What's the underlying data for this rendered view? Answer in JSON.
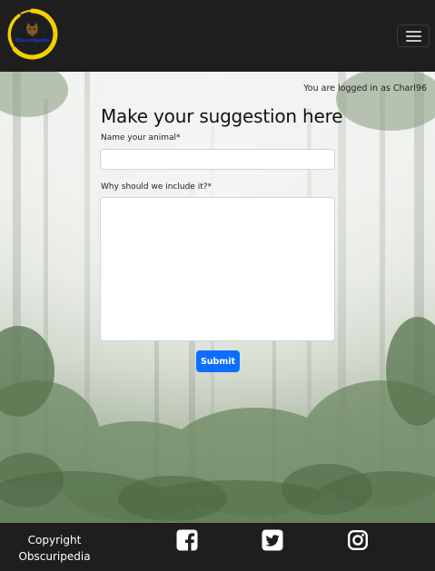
{
  "navbar": {
    "brand": "Obscuripedia",
    "logo_icon": "leopard-logo-icon",
    "menu_icon": "hamburger-menu-icon"
  },
  "main": {
    "login_status": "You are logged in as Charl96",
    "heading": "Make your suggestion here",
    "animal_label": "Name your animal*",
    "animal_value": "",
    "reason_label": "Why should we include it?*",
    "reason_value": "",
    "submit_label": "Submit"
  },
  "footer": {
    "copyright_line1": "Copyright",
    "copyright_line2": "Obscuripedia",
    "social_icons": [
      "facebook-icon",
      "twitter-icon",
      "instagram-icon"
    ]
  },
  "colors": {
    "nav_bg": "#1e1e1e",
    "accent": "#0d6efd",
    "logo_ring": "#f2d000",
    "logo_text": "#1e3bd6"
  }
}
